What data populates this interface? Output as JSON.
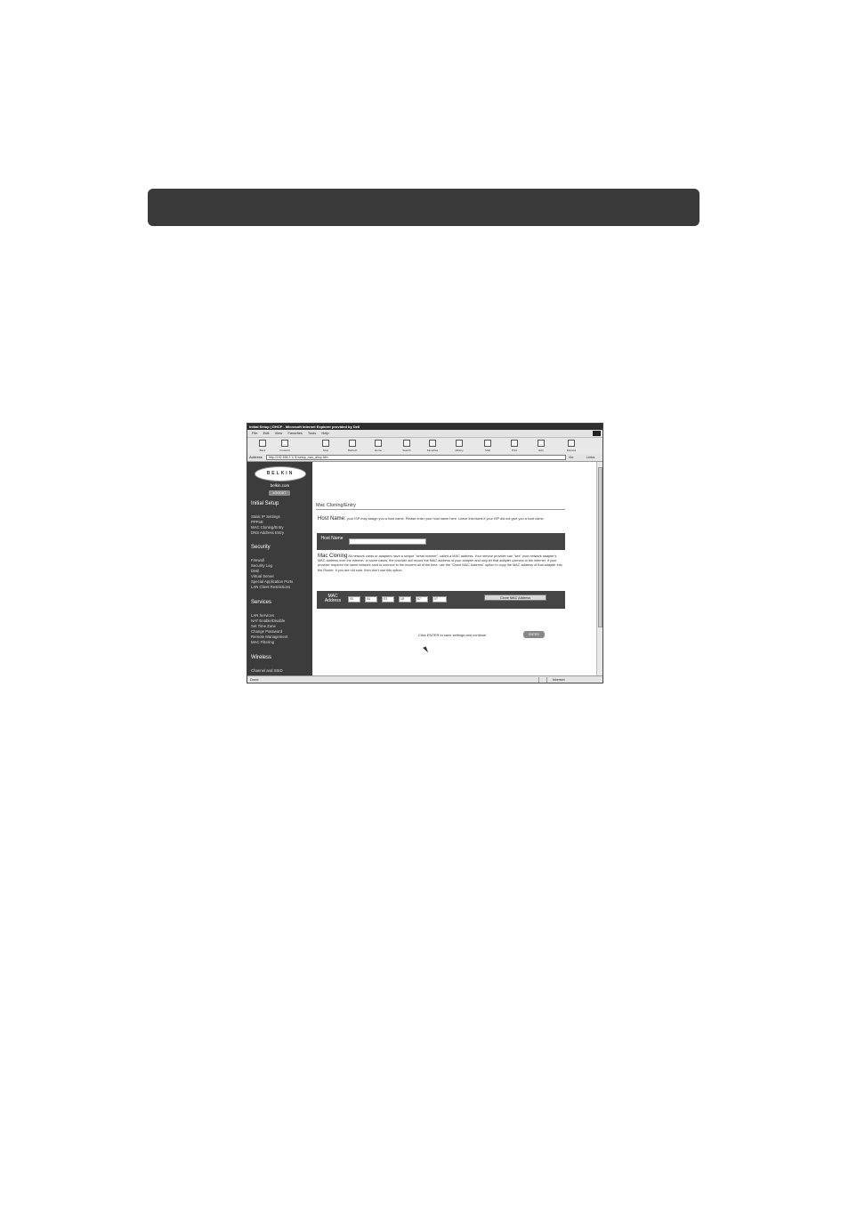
{
  "window": {
    "title": "Initial Setup | DHCP - Microsoft Internet Explorer provided by Dell"
  },
  "menu": [
    "File",
    "Edit",
    "View",
    "Favorites",
    "Tools",
    "Help"
  ],
  "toolbar": [
    "Back",
    "Forward",
    "Stop",
    "Refresh",
    "Home",
    "Search",
    "Favorites",
    "History",
    "Mail",
    "Print",
    "Edit",
    "Discuss"
  ],
  "address": {
    "label": "Address",
    "url": "http://192.168.2.1/ $ /setup_mac_dhcp.htm",
    "go": "Go",
    "links": "Links"
  },
  "sidebar": {
    "logo": "BELKIN",
    "site": "belkin.com",
    "logout": "LOGOUT",
    "sections": [
      {
        "title": "Initial Setup",
        "items": [
          "Static IP Settings",
          "PPPoE",
          "MAC Cloning/Entry",
          "DNS Address Entry"
        ]
      },
      {
        "title": "Security",
        "items": [
          "Firewall",
          "Security Log",
          "DMZ",
          "Virtual Server",
          "Special Application Ports",
          "LAN Client Restrictions"
        ]
      },
      {
        "title": "Services",
        "items": [
          "LAN Services",
          "NAT Enable/Disable",
          "Set Time Zone",
          "Change Password",
          "Remote Management",
          "MAC Filtering"
        ]
      },
      {
        "title": "Wireless",
        "items": [
          "Channel and SSID"
        ]
      }
    ]
  },
  "main": {
    "title": "Mac Cloning/Entry",
    "host_heading": "Host Name:",
    "host_text": "your ISP may assign you a host name. Please enter your host name here. Leave this blank if your ISP did not give you a host name.",
    "host_label": "Host Name",
    "host_value": "",
    "mac_heading": "Mac Cloning",
    "mac_text": "All network cards or adapters have a unique \"serial number\", called a MAC address. Your service provider can \"see\" your network adapter's MAC address over the internet. In some cases, the provider will record the MAC address of your adapter and only let that adapter connect to the internet. If your provider requires the same network card to connect to the modem all of the time, use the \"Clone MAC Address\" option to copy the MAC address of that adapter into the Router. If you are not sure, then don't use this option.",
    "mac_label": "MAC Address",
    "mac_octets": [
      "00",
      "04",
      "E2",
      "18",
      "67",
      "07"
    ],
    "clone_button": "Clone MAC Address",
    "enter_text": "Click ENTER to save settings and continue",
    "enter_button": "ENTER"
  },
  "status": {
    "left": "Done",
    "zone": "Internet"
  }
}
